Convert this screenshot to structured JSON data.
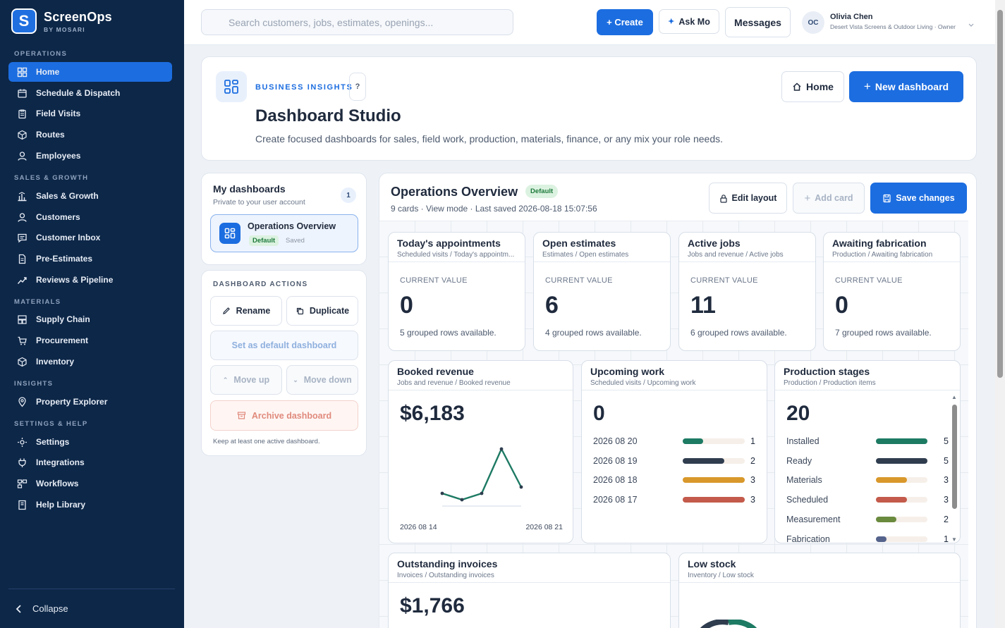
{
  "brand": {
    "name": "ScreenOps",
    "sub": "BY MOSARI",
    "logo_letter": "S",
    "color": "#1c6de0"
  },
  "sidebar": {
    "sections": [
      "OPERATIONS",
      "SALES & GROWTH",
      "MATERIALS",
      "INSIGHTS",
      "SETTINGS & HELP"
    ],
    "items": [
      {
        "label": "Home",
        "icon": "grid-icon"
      },
      {
        "label": "Schedule & Dispatch",
        "icon": "calendar-icon"
      },
      {
        "label": "Field Visits",
        "icon": "clipboard-icon"
      },
      {
        "label": "Routes",
        "icon": "cube-icon"
      },
      {
        "label": "Employees",
        "icon": "user-icon"
      },
      {
        "label": "Sales & Growth",
        "icon": "bar-chart-icon"
      },
      {
        "label": "Customers",
        "icon": "user-icon"
      },
      {
        "label": "Customer Inbox",
        "icon": "message-icon"
      },
      {
        "label": "Pre-Estimates",
        "icon": "document-icon"
      },
      {
        "label": "Reviews & Pipeline",
        "icon": "trend-icon"
      },
      {
        "label": "Supply Chain",
        "icon": "warehouse-icon"
      },
      {
        "label": "Procurement",
        "icon": "cart-icon"
      },
      {
        "label": "Inventory",
        "icon": "cube-icon"
      },
      {
        "label": "Property Explorer",
        "icon": "map-pin-icon"
      },
      {
        "label": "Settings",
        "icon": "sun-icon"
      },
      {
        "label": "Integrations",
        "icon": "plug-icon"
      },
      {
        "label": "Workflows",
        "icon": "workflow-icon"
      },
      {
        "label": "Help Library",
        "icon": "book-icon"
      }
    ],
    "collapse": "Collapse"
  },
  "topbar": {
    "search_placeholder": "Search customers, jobs, estimates, openings...",
    "create": "+ Create",
    "ask": "Ask Mo",
    "messages": "Messages",
    "user_initials": "OC",
    "user_name": "Olivia Chen",
    "user_org": "Desert Vista Screens & Outdoor Living · Owner"
  },
  "header": {
    "eyebrow": "BUSINESS INSIGHTS",
    "help": "?",
    "title": "Dashboard Studio",
    "subtitle": "Create focused dashboards for sales, field work, production, materials, finance, or any mix your role needs.",
    "home": "Home",
    "new_dashboard": "New dashboard"
  },
  "my_dashboards": {
    "title": "My dashboards",
    "subtitle": "Private to your user account",
    "count": "1",
    "item_name": "Operations Overview",
    "item_badge": "Default",
    "item_status": "Saved"
  },
  "actions": {
    "title": "DASHBOARD ACTIONS",
    "rename": "Rename",
    "duplicate": "Duplicate",
    "set_default": "Set as default dashboard",
    "move_up": "Move up",
    "move_down": "Move down",
    "archive": "Archive dashboard",
    "note": "Keep at least one active dashboard."
  },
  "dashboard": {
    "name": "Operations Overview",
    "badge": "Default",
    "meta": "9 cards · View mode · Last saved 2026-08-18 15:07:56",
    "edit_layout": "Edit layout",
    "add_card": "Add card",
    "save_changes": "Save changes"
  },
  "widgets": {
    "appointments": {
      "title": "Today's appointments",
      "sub": "Scheduled visits / Today's appointm...",
      "label": "CURRENT VALUE",
      "value": "0",
      "note": "5 grouped rows available."
    },
    "estimates": {
      "title": "Open estimates",
      "sub": "Estimates / Open estimates",
      "label": "CURRENT VALUE",
      "value": "6",
      "note": "4 grouped rows available."
    },
    "active_jobs": {
      "title": "Active jobs",
      "sub": "Jobs and revenue / Active jobs",
      "label": "CURRENT VALUE",
      "value": "11",
      "note": "6 grouped rows available."
    },
    "fabrication": {
      "title": "Awaiting fabrication",
      "sub": "Production / Awaiting fabrication",
      "label": "CURRENT VALUE",
      "value": "0",
      "note": "7 grouped rows available."
    },
    "revenue": {
      "title": "Booked revenue",
      "sub": "Jobs and revenue / Booked revenue",
      "value": "$6,183",
      "x_start": "2026 08 14",
      "x_end": "2026 08 21"
    },
    "upcoming": {
      "title": "Upcoming work",
      "sub": "Scheduled visits / Upcoming work",
      "value": "0",
      "rows": [
        {
          "label": "2026 08 20",
          "count": 1,
          "color": "#1d7a63"
        },
        {
          "label": "2026 08 19",
          "count": 2,
          "color": "#2f3d4f"
        },
        {
          "label": "2026 08 18",
          "count": 3,
          "color": "#d9982b"
        },
        {
          "label": "2026 08 17",
          "count": 3,
          "color": "#c35a4b"
        }
      ]
    },
    "production": {
      "title": "Production stages",
      "sub": "Production / Production items",
      "value": "20",
      "rows": [
        {
          "label": "Installed",
          "count": 5,
          "color": "#1d7a63"
        },
        {
          "label": "Ready",
          "count": 5,
          "color": "#2f3d4f"
        },
        {
          "label": "Materials",
          "count": 3,
          "color": "#d9982b"
        },
        {
          "label": "Scheduled",
          "count": 3,
          "color": "#c35a4b"
        },
        {
          "label": "Measurement",
          "count": 2,
          "color": "#6a8a3e"
        },
        {
          "label": "Fabrication",
          "count": 1,
          "color": "#55638c"
        }
      ]
    },
    "invoices": {
      "title": "Outstanding invoices",
      "sub": "Invoices / Outstanding invoices",
      "value": "$1,766"
    },
    "low_stock": {
      "title": "Low stock",
      "sub": "Inventory / Low stock"
    }
  },
  "chart_data": {
    "type": "line",
    "title": "Booked revenue",
    "series": [
      {
        "values": [
          2,
          1,
          2,
          9,
          3
        ]
      }
    ],
    "ylim": [
      0,
      10
    ],
    "x_labels": [
      "2026 08 14",
      "2026 08 21"
    ],
    "color": "#1d7a63"
  }
}
